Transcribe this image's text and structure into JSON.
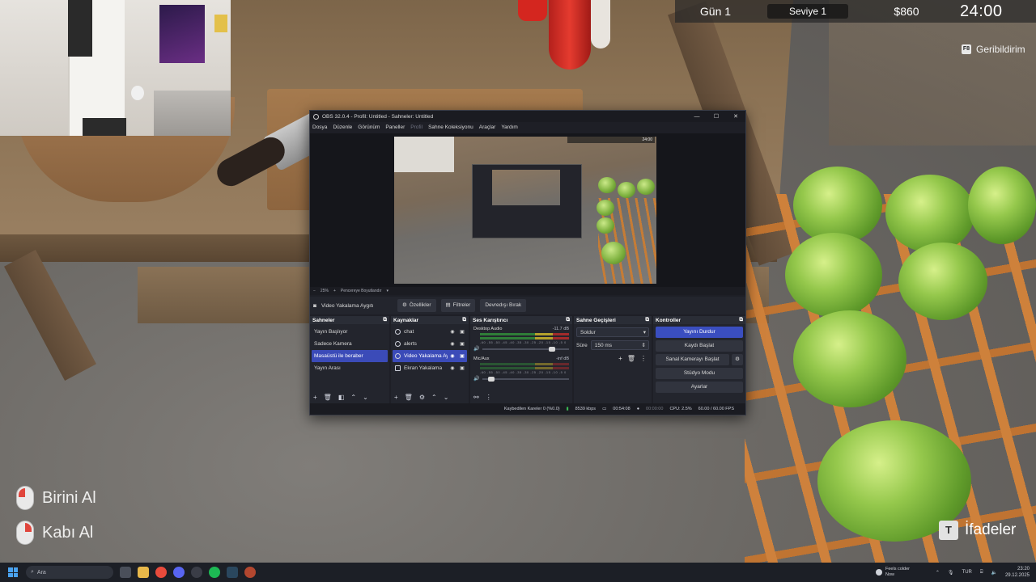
{
  "hud": {
    "day": "Gün 1",
    "level": "Seviye 1",
    "money": "$860",
    "time": "24:00",
    "feedback_key": "F8",
    "feedback_label": "Geribildirim"
  },
  "actions": [
    {
      "label": "Birini Al",
      "icon": "mouse-left-icon"
    },
    {
      "label": "Kabı Al",
      "icon": "mouse-right-icon"
    }
  ],
  "emotes": {
    "key": "T",
    "label": "İfadeler"
  },
  "obs": {
    "window_title": "OBS 32.0.4 - Profil: Untitled - Sahneler: Untitled",
    "menu": [
      "Dosya",
      "Düzenle",
      "Görünüm",
      "Paneller",
      "Profil",
      "Sahne Koleksiyonu",
      "Araçlar",
      "Yardım"
    ],
    "preview": {
      "zoom": "25%",
      "fit_label": "Pencereye Boyutlandır",
      "inner_time": "24:00"
    },
    "source_bar": {
      "current_source": "Video Yakalama Aygıtı",
      "properties": "Özellikler",
      "filters": "Filtreler",
      "deactivate": "Devredışı Bırak"
    },
    "scenes": {
      "title": "Sahneler",
      "items": [
        "Yayın Başlıyor",
        "Sadece Kamera",
        "Masaüstü ile beraber",
        "Yayın Arası"
      ],
      "selected": "Masaüstü ile beraber"
    },
    "sources": {
      "title": "Kaynaklar",
      "items": [
        "chat",
        "alerts",
        "Video Yakalama Aygıtı",
        "Ekran Yakalama"
      ],
      "selected": "Video Yakalama Aygıtı"
    },
    "mixer": {
      "title": "Ses Karıştırıcı",
      "channels": [
        {
          "name": "Desktop Audio",
          "db": "-11.7 dB",
          "volume": 0.8
        },
        {
          "name": "Mic/Aux",
          "db": "-inf dB",
          "volume": 0.1
        }
      ],
      "ticks": "-60 -55 -50 -45 -40 -35 -30 -25 -20 -15 -10 -5 0"
    },
    "transitions": {
      "title": "Sahne Geçişleri",
      "type": "Soldur",
      "duration_label": "Süre",
      "duration": "150 ms"
    },
    "controls": {
      "title": "Kontroller",
      "stop_stream": "Yayını Durdur",
      "start_record": "Kaydı Başlat",
      "virtual_cam": "Sanal Kamerayı Başlat",
      "studio_mode": "Stüdyo Modu",
      "settings": "Ayarlar"
    },
    "status": {
      "dropped": "Kaybedilen Kareler 0 (%0.0)",
      "bitrate": "8539 kbps",
      "stream_time": "00:54:08",
      "record_time": "00:00:00",
      "cpu": "CPU: 2.5%",
      "fps": "60.00 / 60.00 FPS"
    }
  },
  "taskbar": {
    "search_placeholder": "Ara",
    "weather": "Feels colder",
    "weather_sub": "Now",
    "language": "TUR",
    "time": "23:20",
    "date": "29.12.2025"
  },
  "colors": {
    "obs_accent": "#3b4bb8",
    "hud_bg": "#282828",
    "crate": "#d4833a",
    "lettuce": "#95c84c"
  }
}
